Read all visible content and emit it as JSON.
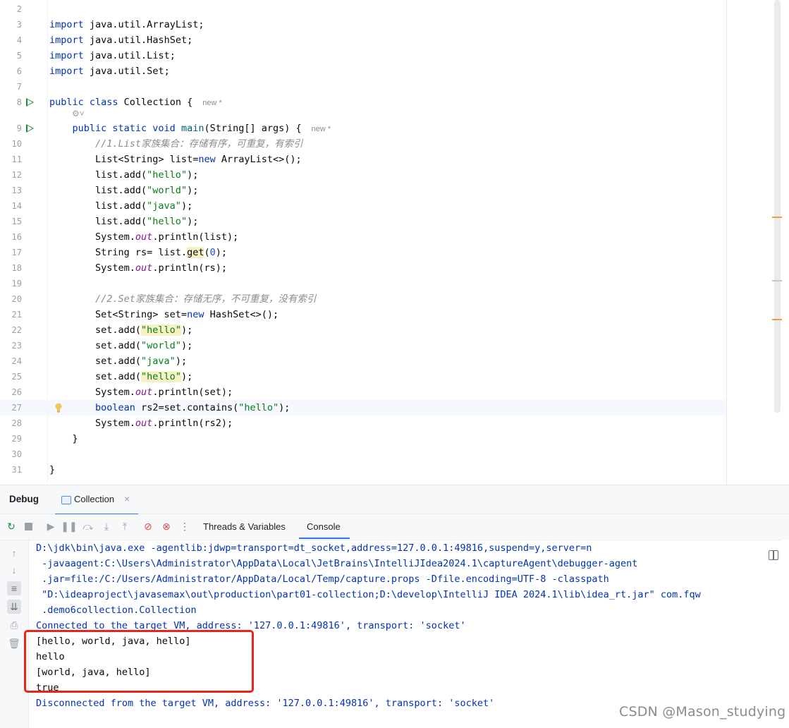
{
  "editor": {
    "lines": [
      {
        "n": "2",
        "html": ""
      },
      {
        "n": "3",
        "html": "<span class=\"kw\">import</span> java.util.ArrayList;"
      },
      {
        "n": "4",
        "html": "<span class=\"kw\">import</span> java.util.HashSet;"
      },
      {
        "n": "5",
        "html": "<span class=\"kw\">import</span> java.util.List;"
      },
      {
        "n": "6",
        "html": "<span class=\"kw\">import</span> java.util.Set;"
      },
      {
        "n": "7",
        "html": ""
      },
      {
        "n": "8",
        "html": "<span class=\"kw\">public class</span> Collection {<span class=\"hint\">new *</span>",
        "run": true
      },
      {
        "n": "9",
        "html": "    <span class=\"kw\">public static void</span> <span class=\"fn\">main</span>(String[] args) {<span class=\"hint\">new *</span>",
        "run": true
      },
      {
        "n": "10",
        "html": "        <span class=\"cmt\">//1.List家族集合：存储有序，可重复，有索引</span>"
      },
      {
        "n": "11",
        "html": "        List&lt;String&gt; list=<span class=\"kw\">new</span> ArrayList&lt;&gt;();"
      },
      {
        "n": "12",
        "html": "        list.add(<span class=\"str\">\"hello\"</span>);"
      },
      {
        "n": "13",
        "html": "        list.add(<span class=\"str\">\"world\"</span>);"
      },
      {
        "n": "14",
        "html": "        list.add(<span class=\"str\">\"java\"</span>);"
      },
      {
        "n": "15",
        "html": "        list.add(<span class=\"str\">\"hello\"</span>);"
      },
      {
        "n": "16",
        "html": "        System.<span class=\"fld\">out</span>.println(list);"
      },
      {
        "n": "17",
        "html": "        String rs= list.<span class=\"hl\">get</span>(<span class=\"num\">0</span>);"
      },
      {
        "n": "18",
        "html": "        System.<span class=\"fld\">out</span>.println(rs);"
      },
      {
        "n": "19",
        "html": ""
      },
      {
        "n": "20",
        "html": "        <span class=\"cmt\">//2.Set家族集合：存储无序，不可重复，没有索引</span>"
      },
      {
        "n": "21",
        "html": "        Set&lt;String&gt; set=<span class=\"kw\">new</span> HashSet&lt;&gt;();"
      },
      {
        "n": "22",
        "html": "        set.add(<span class=\"str hl\">\"hello\"</span>);"
      },
      {
        "n": "23",
        "html": "        set.add(<span class=\"str\">\"world\"</span>);"
      },
      {
        "n": "24",
        "html": "        set.add(<span class=\"str\">\"java\"</span>);"
      },
      {
        "n": "25",
        "html": "        set.add(<span class=\"str hl\">\"hello\"</span>);"
      },
      {
        "n": "26",
        "html": "        System.<span class=\"fld\">out</span>.println(set);"
      },
      {
        "n": "27",
        "html": "        <span class=\"kw\">boolean</span> rs2=set.contains(<span class=\"str\">\"hello\"</span>);",
        "current": true
      },
      {
        "n": "28",
        "html": "        System.<span class=\"fld\">out</span>.println(rs2);"
      },
      {
        "n": "29",
        "html": "    }"
      },
      {
        "n": "30",
        "html": ""
      },
      {
        "n": "31",
        "html": "}"
      }
    ]
  },
  "debug": {
    "title": "Debug",
    "session_tab": "Collection",
    "tabs": {
      "threads": "Threads & Variables",
      "console": "Console"
    },
    "console_lines": [
      {
        "text": "D:\\jdk\\bin\\java.exe -agentlib:jdwp=transport=dt_socket,address=127.0.0.1:49816,suspend=y,server=n",
        "kind": "sys"
      },
      {
        "text": " -javaagent:C:\\Users\\Administrator\\AppData\\Local\\JetBrains\\IntelliJIdea2024.1\\captureAgent\\debugger-agent",
        "kind": "sys"
      },
      {
        "text": " .jar=file:/C:/Users/Administrator/AppData/Local/Temp/capture.props -Dfile.encoding=UTF-8 -classpath",
        "kind": "sys"
      },
      {
        "text": " \"D:\\ideaproject\\javasemax\\out\\production\\part01-collection;D:\\develop\\IntelliJ IDEA 2024.1\\lib\\idea_rt.jar\" com.fqw",
        "kind": "sys"
      },
      {
        "text": " .demo6collection.Collection",
        "kind": "sys"
      },
      {
        "text": "Connected to the target VM, address: '127.0.0.1:49816', transport: 'socket'",
        "kind": "sys"
      },
      {
        "text": "[hello, world, java, hello]",
        "kind": "out"
      },
      {
        "text": "hello",
        "kind": "out"
      },
      {
        "text": "[world, java, hello]",
        "kind": "out"
      },
      {
        "text": "true",
        "kind": "out"
      },
      {
        "text": "Disconnected from the target VM, address: '127.0.0.1:49816', transport: 'socket'",
        "kind": "sys"
      }
    ]
  },
  "watermark": "CSDN @Mason_studying",
  "colors": {
    "accent": "#3574f0",
    "highlight_box": "#e8241c",
    "keyword": "#0033b3",
    "string": "#067d17"
  }
}
